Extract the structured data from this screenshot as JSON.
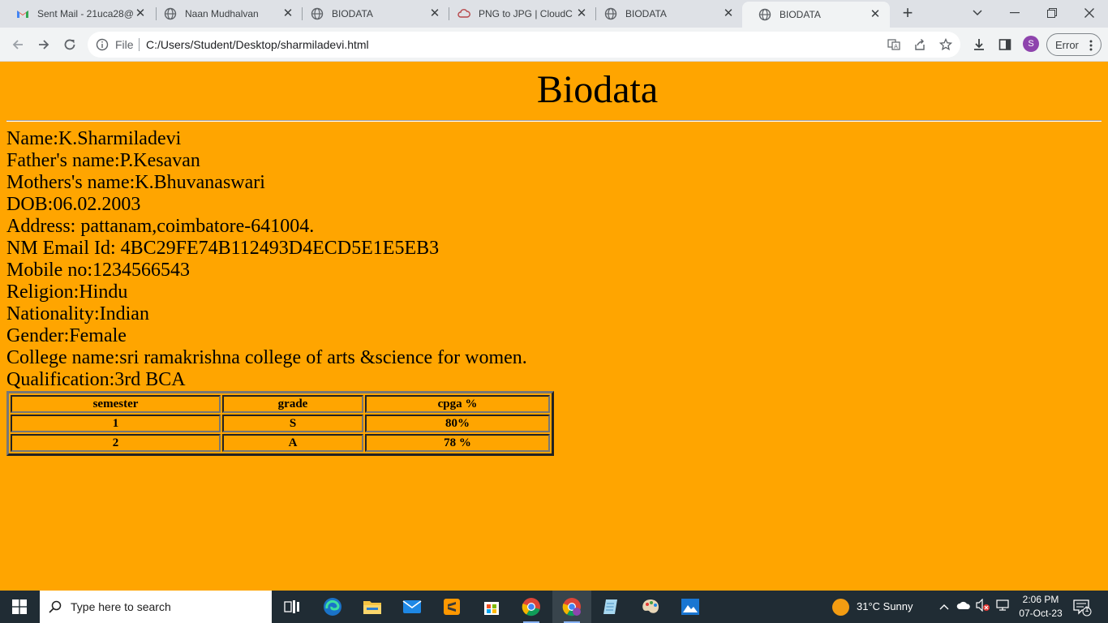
{
  "browser": {
    "tabs": [
      {
        "title": "Sent Mail - 21uca28@",
        "icon": "gmail-icon"
      },
      {
        "title": "Naan Mudhalvan",
        "icon": "globe-icon"
      },
      {
        "title": "BIODATA",
        "icon": "globe-icon"
      },
      {
        "title": "PNG to JPG | CloudC",
        "icon": "cloudconvert-icon"
      },
      {
        "title": "BIODATA",
        "icon": "globe-icon"
      },
      {
        "title": "BIODATA",
        "icon": "globe-icon",
        "active": true
      }
    ],
    "omnibox": {
      "scheme_label": "File",
      "url": "C:/Users/Student/Desktop/sharmiladevi.html"
    },
    "profile_initial": "S",
    "error_label": "Error"
  },
  "page": {
    "title": "Biodata",
    "info_lines": [
      "Name:K.Sharmiladevi",
      "Father's name:P.Kesavan",
      "Mothers's name:K.Bhuvanaswari",
      "DOB:06.02.2003",
      "Address: pattanam,coimbatore-641004.",
      "NM Email Id: 4BC29FE74B112493D4ECD5E1E5EB3",
      "Mobile no:1234566543",
      "Religion:Hindu",
      "Nationality:Indian",
      "Gender:Female",
      "College name:sri ramakrishna college of arts &science for women.",
      "Qualification:3rd BCA"
    ],
    "table": {
      "headers": [
        "semester",
        "grade",
        "cpga %"
      ],
      "rows": [
        [
          "1",
          "S",
          "80%"
        ],
        [
          "2",
          "A",
          "78 %"
        ]
      ]
    },
    "background_color": "#ffa500"
  },
  "taskbar": {
    "search_placeholder": "Type here to search",
    "weather": "31°C  Sunny",
    "time": "2:06 PM",
    "date": "07-Oct-23",
    "notification_count": "1"
  }
}
